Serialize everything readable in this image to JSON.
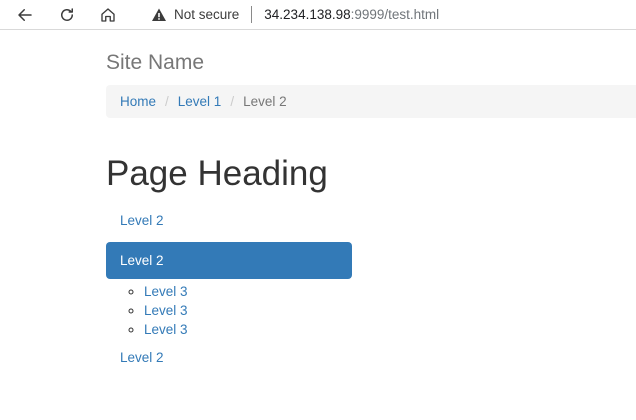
{
  "browser": {
    "security_label": "Not secure",
    "url_host": "34.234.138.98",
    "url_rest": ":9999/test.html"
  },
  "site": {
    "name": "Site Name"
  },
  "breadcrumb": {
    "items": [
      {
        "label": "Home"
      },
      {
        "label": "Level 1"
      }
    ],
    "active": "Level 2",
    "separator": "/"
  },
  "page": {
    "heading": "Page Heading"
  },
  "nav": {
    "items": [
      {
        "label": "Level 2"
      },
      {
        "label": "Level 2",
        "active": true,
        "children": [
          {
            "label": "Level 3"
          },
          {
            "label": "Level 3"
          },
          {
            "label": "Level 3"
          }
        ]
      },
      {
        "label": "Level 2"
      }
    ]
  },
  "colors": {
    "link": "#337ab7",
    "active_bg": "#337ab7",
    "breadcrumb_bg": "#f5f5f5"
  }
}
